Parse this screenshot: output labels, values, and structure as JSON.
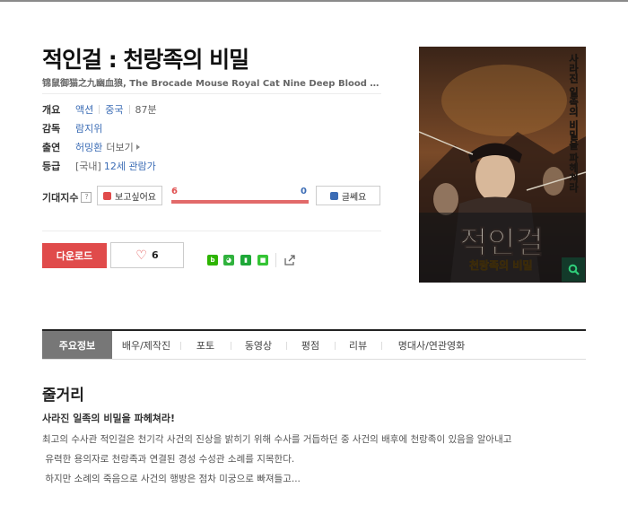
{
  "movie": {
    "title": "적인걸 : 천랑족의 비밀",
    "alt_title": "锦鼠御猫之九幽血狼, The Brocade Mouse Royal Cat Nine Deep Blood Wolf"
  },
  "info": {
    "overview_label": "개요",
    "genre": "액션",
    "country": "중국",
    "runtime": "87분",
    "director_label": "감독",
    "director": "람지위",
    "cast_label": "출연",
    "cast": "허밍환",
    "cast_more": "더보기",
    "rating_label": "등급",
    "rating_prefix": "[국내]",
    "rating": "12세 관람가"
  },
  "expectation": {
    "label": "기대지수",
    "help_icon": "?",
    "want_label": "보고싶어요",
    "want_count": "6",
    "meh_label": "글쎄요",
    "meh_count": "0",
    "want_ratio": 1.0,
    "accent_red": "#e04b4b",
    "accent_blue": "#3b6cb5"
  },
  "actions": {
    "download_label": "다운로드",
    "like_count": "6",
    "share_icons": [
      "blog-share-icon",
      "band-share-icon",
      "bookmark-share-icon",
      "kakao-share-icon",
      "external-share-icon"
    ]
  },
  "poster": {
    "vertical_text": "사라진 일족의 비밀을 파헤쳐라",
    "title_big": "적인걸",
    "title_sub": "천랑족의 비밀",
    "zoom_icon": "search-icon"
  },
  "tabs": [
    "주요정보",
    "배우/제작진",
    "포토",
    "동영상",
    "평점",
    "리뷰",
    "명대사/연관영화"
  ],
  "synopsis": {
    "heading": "줄거리",
    "tagline": "사라진 일족의 비밀을 파헤쳐라!",
    "lines": [
      "최고의 수사관 적인걸은 천기각 사건의 진상을 밝히기 위해 수사를 거듭하던 중 사건의 배후에 천랑족이 있음을 알아내고",
      " 유력한 용의자로 천랑족과 연결된 경성 수성관 소례를 지목한다.",
      " 하지만 소례의 죽음으로 사건의 행방은 점차 미궁으로 빠져들고..."
    ]
  }
}
